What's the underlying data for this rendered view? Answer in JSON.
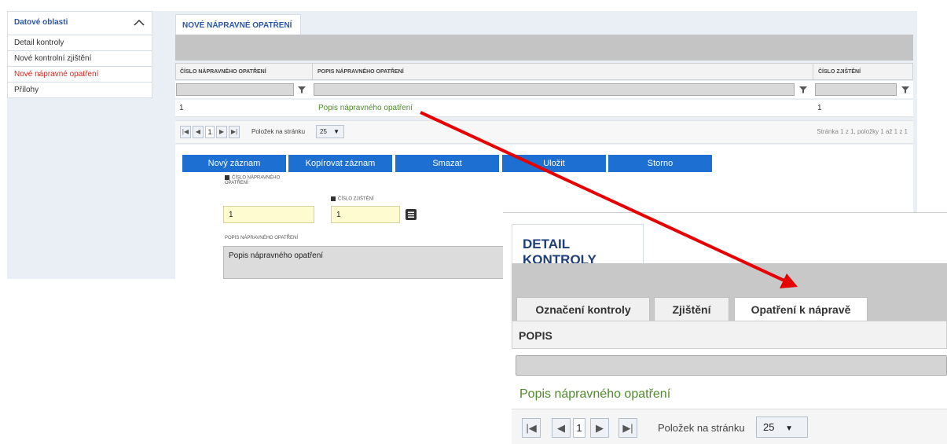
{
  "sidebar": {
    "title": "Datové oblasti",
    "items": [
      {
        "label": "Detail kontroly"
      },
      {
        "label": "Nové kontrolní zjištění"
      },
      {
        "label": "Nové nápravné opatření"
      },
      {
        "label": "Přílohy"
      }
    ]
  },
  "main": {
    "tab_label": "NOVÉ NÁPRAVNÉ OPATŘENÍ",
    "columns": [
      "ČÍSLO NÁPRAVNÉHO OPATŘENÍ",
      "POPIS NÁPRAVNÉHO OPATŘENÍ",
      "ČÍSLO ZJIŠTĚNÍ"
    ],
    "rows": [
      {
        "cislo": "1",
        "popis": "Popis nápravného opatření",
        "zjisteni": "1"
      }
    ],
    "pager": {
      "page": "1",
      "per_page_label": "Položek na stránku",
      "per_page": "25",
      "info": "Stránka 1 z 1, položky 1 až 1 z 1"
    },
    "buttons": {
      "new": "Nový záznam",
      "copy": "Kopírovat záznam",
      "delete": "Smazat",
      "save": "Uložit",
      "cancel": "Storno"
    },
    "form": {
      "cislo_label": "ČÍSLO NÁPRAVNÉHO OPATŘENÍ",
      "cislo_value": "1",
      "zjisteni_label": "ČÍSLO ZJIŠTĚNÍ",
      "zjisteni_value": "1",
      "popis_label": "POPIS NÁPRAVNÉHO OPATŘENÍ",
      "popis_value": "Popis nápravného opatření"
    }
  },
  "zoom": {
    "tab_label": "DETAIL KONTROLY",
    "subtabs": [
      "Označení kontroly",
      "Zjištění",
      "Opatření k nápravě"
    ],
    "column": "POPIS",
    "row_text": "Popis nápravného opatření",
    "pager": {
      "page": "1",
      "per_page_label": "Položek na stránku",
      "per_page": "25"
    }
  },
  "colors": {
    "accent_blue": "#1e6fd2",
    "active_red": "#e2231a",
    "link_green": "#4f8a2b",
    "arrow_red": "#e60000"
  }
}
